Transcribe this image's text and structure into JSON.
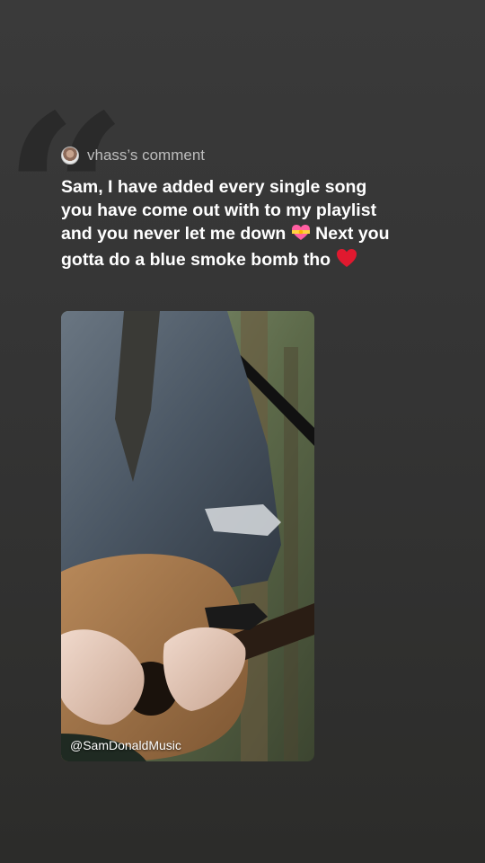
{
  "comment": {
    "author_label": "vhass’s comment",
    "text_part1": "Sam, I have added every single song you have come out with to my playlist and you never let me down ",
    "emoji1": "heart-with-ribbon-icon",
    "text_part2": " Next you gotta do a blue smoke bomb tho",
    "emoji2": "red-heart-icon"
  },
  "video": {
    "watermark": "@SamDonaldMusic"
  },
  "colors": {
    "background_top": "#3a3a3a",
    "background_bottom": "#2c2c2a",
    "author_text": "#bdbdbd",
    "comment_text": "#ffffff"
  }
}
